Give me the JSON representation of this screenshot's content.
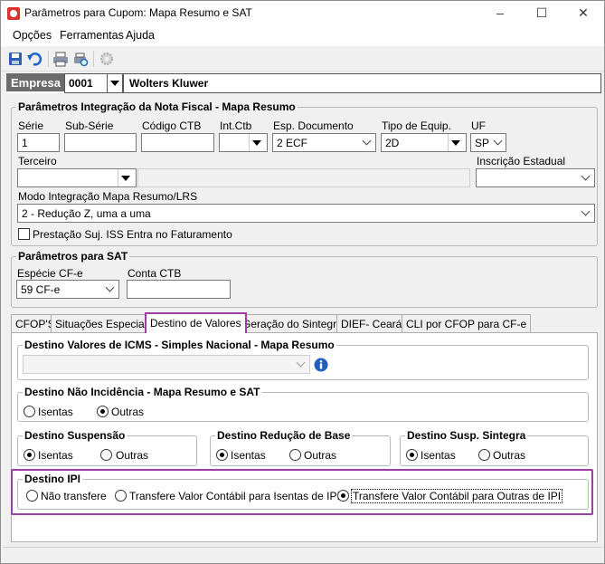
{
  "window": {
    "title": "Parâmetros para Cupom: Mapa Resumo e SAT"
  },
  "menu": [
    "Opções",
    "Ferramentas",
    "Ajuda"
  ],
  "toolbar": [
    "save-icon",
    "undo-icon",
    "print-icon",
    "print-preview-icon",
    "settings-icon"
  ],
  "empresa": {
    "label": "Empresa",
    "code": "0001",
    "name": "Wolters Kluwer"
  },
  "nf": {
    "title": "Parâmetros Integração da Nota Fiscal - Mapa Resumo",
    "serie_label": "Série",
    "serie": "1",
    "subserie_label": "Sub-Série",
    "subserie": "",
    "ctb_label": "Código CTB",
    "ctb": "",
    "intctb_label": "Int.Ctb",
    "intctb": "",
    "espdoc_label": "Esp. Documento",
    "espdoc": "2 ECF",
    "tipo_label": "Tipo de Equip.",
    "tipo": "2D",
    "uf_label": "UF",
    "uf": "SP",
    "terceiro_label": "Terceiro",
    "terceiro": "",
    "ie_label": "Inscrição Estadual",
    "ie": "",
    "modo_label": "Modo Integração Mapa Resumo/LRS",
    "modo": "2 - Redução Z, uma a uma",
    "prestacao_label": "Prestação Suj. ISS Entra no Faturamento"
  },
  "sat": {
    "title": "Parâmetros para SAT",
    "especie_label": "Espécie CF-e",
    "especie": "59 CF-e",
    "conta_label": "Conta CTB",
    "conta": ""
  },
  "tabs": [
    "CFOP'S",
    "Situações Especiais",
    "Destino de Valores",
    "Geração do Sintegra",
    "DIEF- Ceará",
    "CLI por CFOP para CF-e"
  ],
  "icms": {
    "title": "Destino Valores de ICMS - Simples Nacional - Mapa Resumo",
    "value": ""
  },
  "nao_incidencia": {
    "title": "Destino Não Incidência - Mapa Resumo e SAT",
    "opt1": "Isentas",
    "opt2": "Outras"
  },
  "suspensao": {
    "title": "Destino Suspensão",
    "opt1": "Isentas",
    "opt2": "Outras"
  },
  "reducao": {
    "title": "Destino Redução de Base",
    "opt1": "Isentas",
    "opt2": "Outras"
  },
  "susp_sintegra": {
    "title": "Destino Susp. Sintegra",
    "opt1": "Isentas",
    "opt2": "Outras"
  },
  "ipi": {
    "title": "Destino IPI",
    "opt1": "Não transfere",
    "opt2": "Transfere Valor Contábil para Isentas de IPI",
    "opt3": "Transfere Valor Contábil para Outras de IPI"
  },
  "colors": {
    "highlight": "#9b3fa3",
    "empresa_bg": "#6b6b6b"
  }
}
